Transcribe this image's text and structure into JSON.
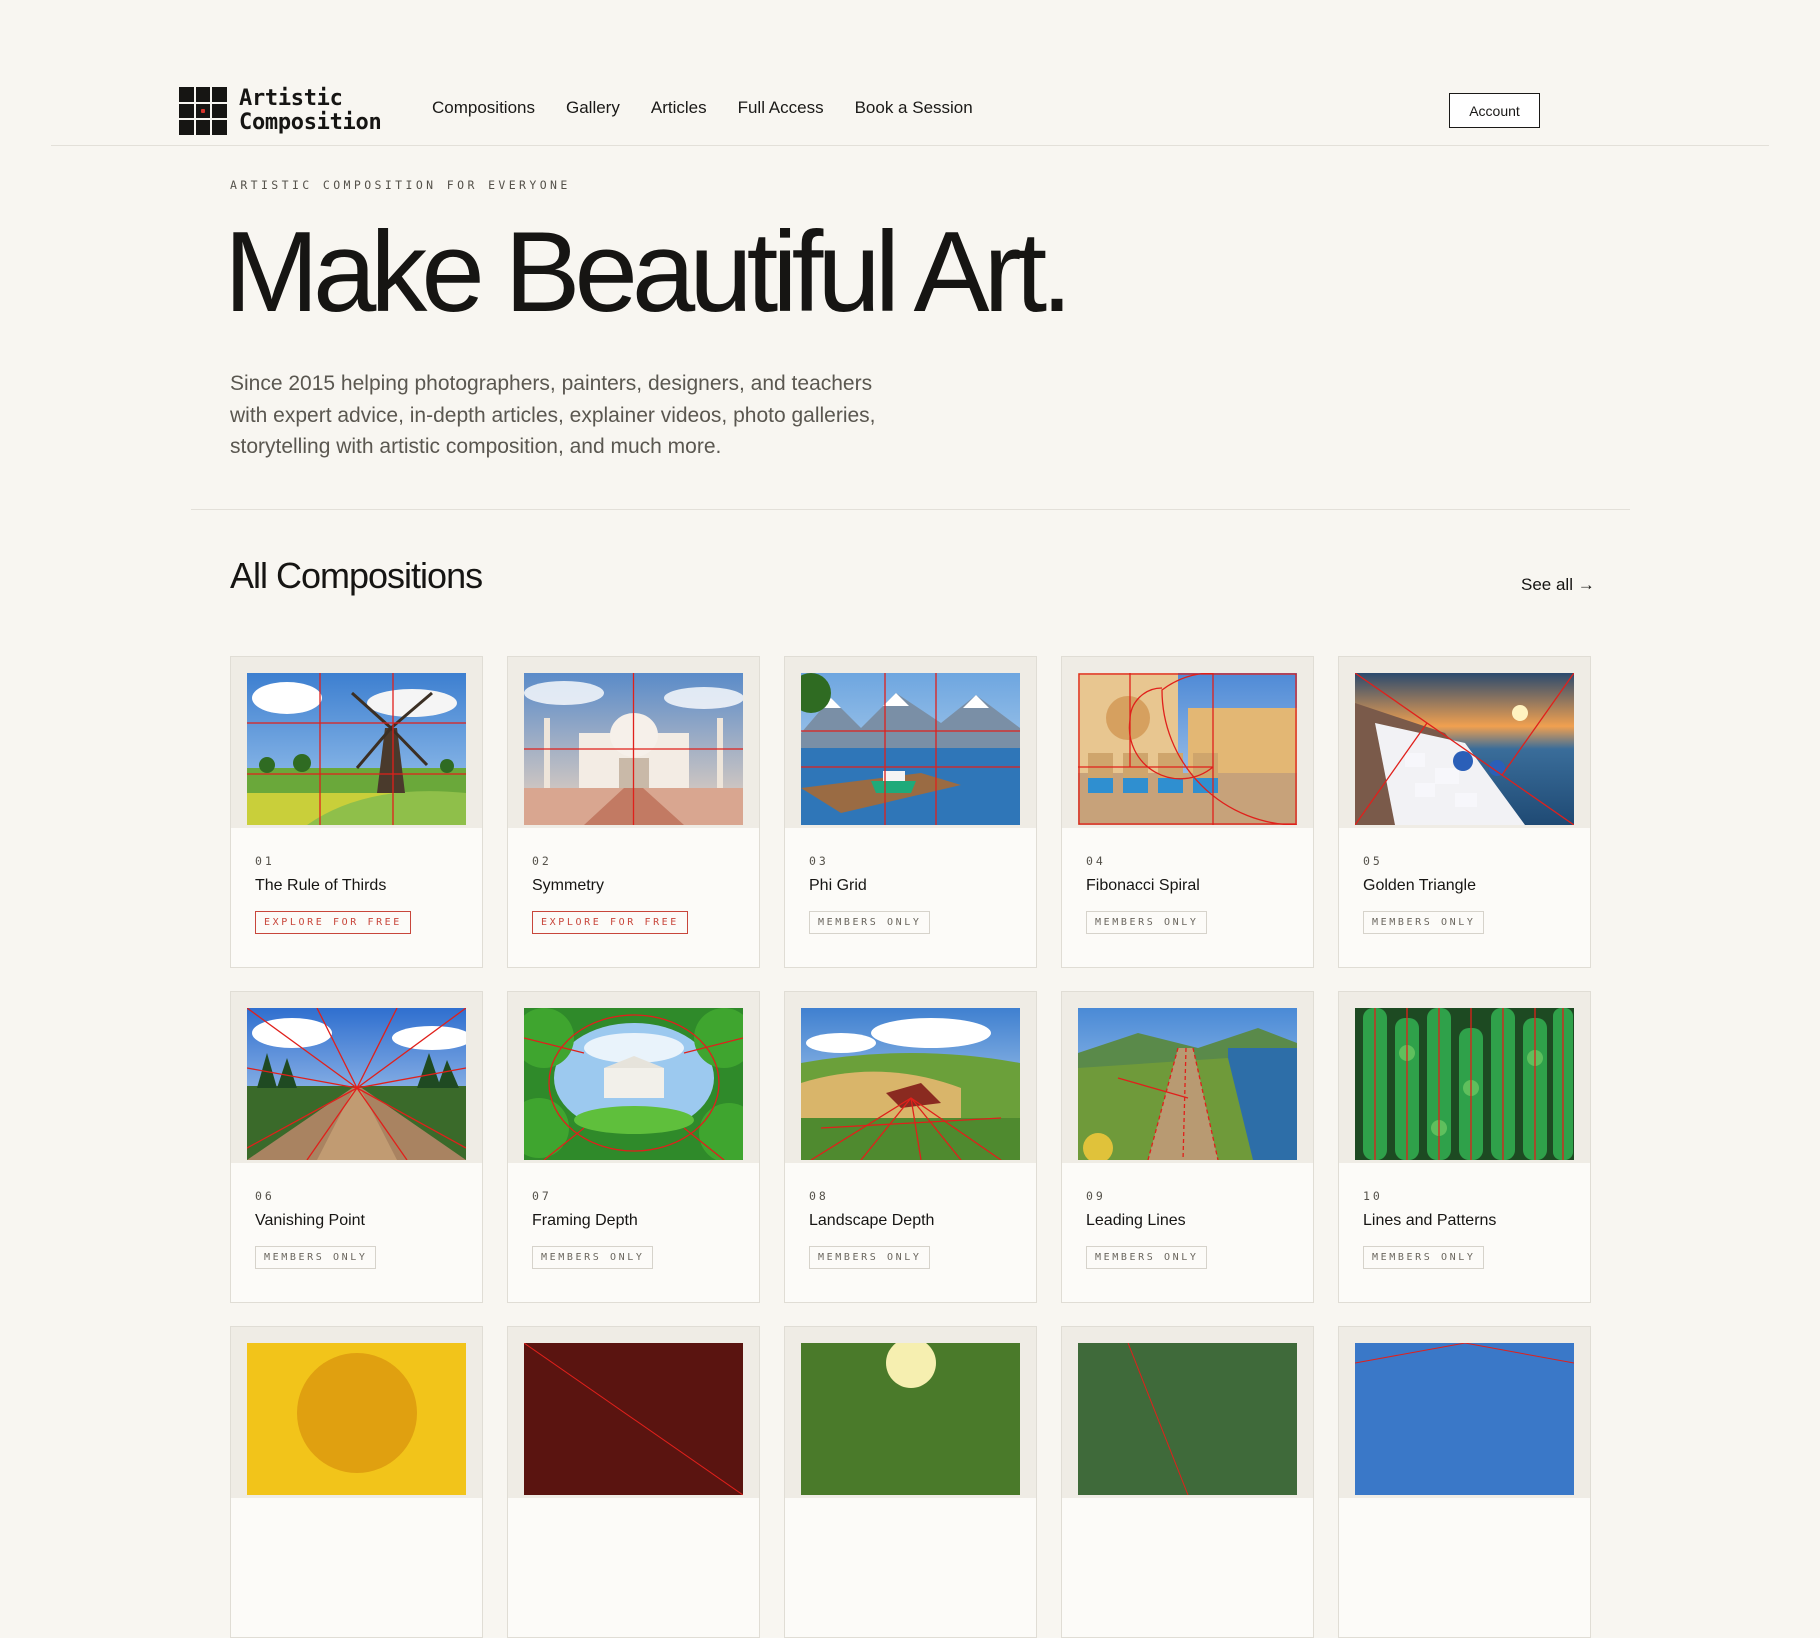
{
  "brand": {
    "line1": "Artistic",
    "line2": "Composition"
  },
  "nav": {
    "items": [
      "Compositions",
      "Gallery",
      "Articles",
      "Full Access",
      "Book a Session"
    ],
    "account_label": "Account"
  },
  "hero": {
    "eyebrow": "ARTISTIC COMPOSITION FOR EVERYONE",
    "title": "Make Beautiful Art.",
    "description": "Since 2015 helping photographers, painters, designers, and teachers with expert advice, in-depth articles, explainer videos, photo galleries, storytelling with artistic composition, and much more."
  },
  "section": {
    "title": "All Compositions",
    "see_all": "See all →"
  },
  "colors": {
    "accent": "#c8463b",
    "background": "#f8f6f1",
    "ink": "#161513"
  },
  "compositions": [
    {
      "num": "01",
      "name": "The Rule of Thirds",
      "badge": "EXPLORE FOR FREE",
      "access": "free",
      "overlay": "thirds"
    },
    {
      "num": "02",
      "name": "Symmetry",
      "badge": "EXPLORE FOR FREE",
      "access": "free",
      "overlay": "symmetry"
    },
    {
      "num": "03",
      "name": "Phi Grid",
      "badge": "MEMBERS ONLY",
      "access": "members",
      "overlay": "phi"
    },
    {
      "num": "04",
      "name": "Fibonacci Spiral",
      "badge": "MEMBERS ONLY",
      "access": "members",
      "overlay": "spiral"
    },
    {
      "num": "05",
      "name": "Golden Triangle",
      "badge": "MEMBERS ONLY",
      "access": "members",
      "overlay": "triangle"
    },
    {
      "num": "06",
      "name": "Vanishing Point",
      "badge": "MEMBERS ONLY",
      "access": "members",
      "overlay": "vanishing"
    },
    {
      "num": "07",
      "name": "Framing Depth",
      "badge": "MEMBERS ONLY",
      "access": "members",
      "overlay": "framing"
    },
    {
      "num": "08",
      "name": "Landscape Depth",
      "badge": "MEMBERS ONLY",
      "access": "members",
      "overlay": "landscape"
    },
    {
      "num": "09",
      "name": "Leading Lines",
      "badge": "MEMBERS ONLY",
      "access": "members",
      "overlay": "leading"
    },
    {
      "num": "10",
      "name": "Lines and Patterns",
      "badge": "MEMBERS ONLY",
      "access": "members",
      "overlay": "patterns"
    }
  ]
}
